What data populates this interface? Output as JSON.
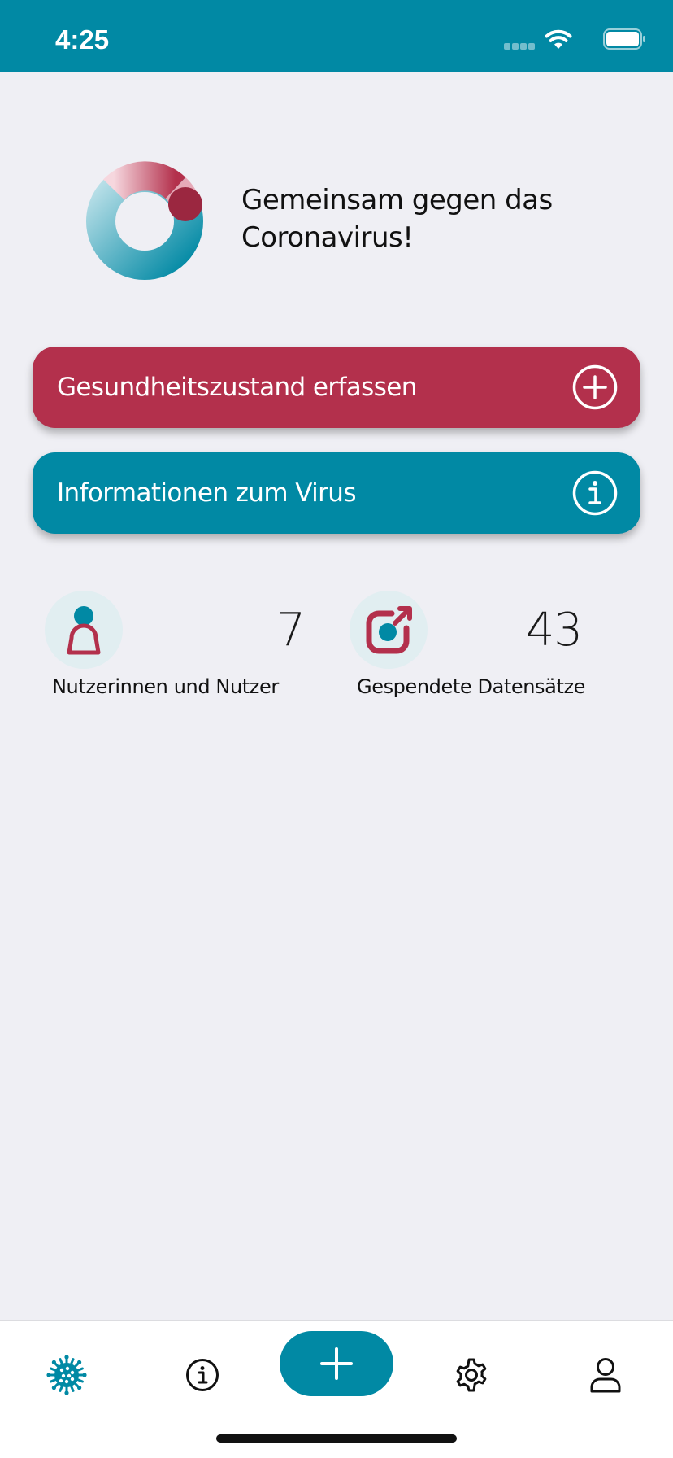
{
  "status_bar": {
    "time": "4:25",
    "icons": [
      "cellular-signal-icon",
      "wifi-icon",
      "battery-icon"
    ],
    "background": "#0189a4"
  },
  "hero": {
    "logo": "app-logo-ring",
    "title": "Gemeinsam gegen das Coronavirus!"
  },
  "actions": [
    {
      "label": "Gesundheitszustand erfassen",
      "icon": "plus-circle-icon",
      "color": "#b3304c"
    },
    {
      "label": "Informationen zum Virus",
      "icon": "info-circle-icon",
      "color": "#0189a4"
    }
  ],
  "stats": [
    {
      "value": "7",
      "label": "Nutzerinnen und Nutzer",
      "icon": "user-icon"
    },
    {
      "value": "43",
      "label": "Gespendete Datensätze",
      "icon": "data-share-icon"
    }
  ],
  "tab_bar": {
    "tabs": [
      {
        "icon": "virus-icon",
        "active": true
      },
      {
        "icon": "info-icon",
        "active": false
      },
      {
        "icon": "plus-icon",
        "active": false
      },
      {
        "icon": "gear-icon",
        "active": false
      },
      {
        "icon": "profile-icon",
        "active": false
      }
    ],
    "accent": "#0189a4"
  },
  "colors": {
    "primary": "#0189a4",
    "secondary": "#b3304c",
    "background": "#efeff4"
  }
}
